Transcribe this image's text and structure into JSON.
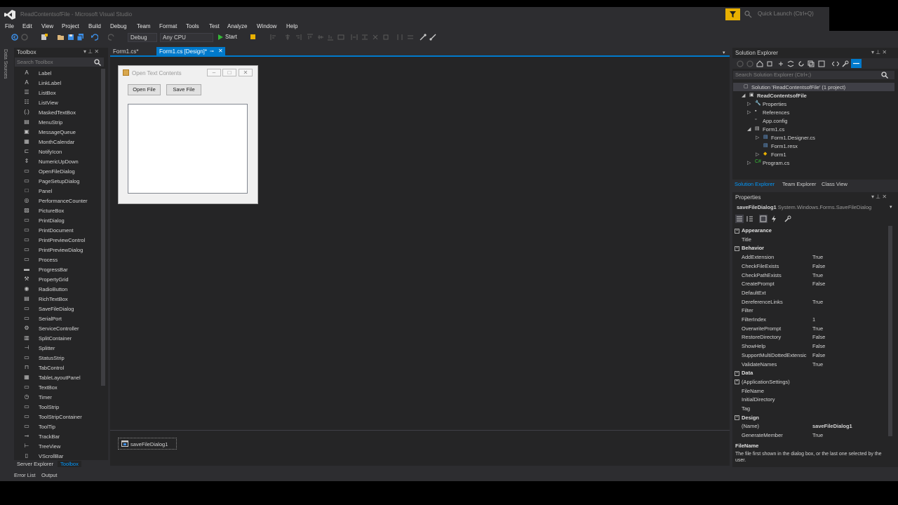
{
  "window": {
    "title": "ReadContentsofFile - Microsoft Visual Studio",
    "quick_launch_placeholder": "Quick Launch (Ctrl+Q)"
  },
  "menu": [
    "File",
    "Edit",
    "View",
    "Project",
    "Build",
    "Debug",
    "Team",
    "Format",
    "Tools",
    "Test",
    "Analyze",
    "Window",
    "Help"
  ],
  "toolbar": {
    "configuration": "Debug",
    "platform": "Any CPU",
    "start_label": "Start"
  },
  "side_strip": {
    "data_sources": "Data Sources"
  },
  "toolbox": {
    "title": "Toolbox",
    "search_placeholder": "Search Toolbox",
    "items": [
      {
        "icon": "A",
        "label": "Label"
      },
      {
        "icon": "A",
        "label": "LinkLabel"
      },
      {
        "icon": "☰",
        "label": "ListBox"
      },
      {
        "icon": "☷",
        "label": "ListView"
      },
      {
        "icon": "(.)",
        "label": "MaskedTextBox"
      },
      {
        "icon": "▤",
        "label": "MenuStrip"
      },
      {
        "icon": "▣",
        "label": "MessageQueue"
      },
      {
        "icon": "▦",
        "label": "MonthCalendar"
      },
      {
        "icon": "⊏",
        "label": "NotifyIcon"
      },
      {
        "icon": "⇕",
        "label": "NumericUpDown"
      },
      {
        "icon": "▭",
        "label": "OpenFileDialog"
      },
      {
        "icon": "▭",
        "label": "PageSetupDialog"
      },
      {
        "icon": "□",
        "label": "Panel"
      },
      {
        "icon": "◎",
        "label": "PerformanceCounter"
      },
      {
        "icon": "▨",
        "label": "PictureBox"
      },
      {
        "icon": "▭",
        "label": "PrintDialog"
      },
      {
        "icon": "▭",
        "label": "PrintDocument"
      },
      {
        "icon": "▭",
        "label": "PrintPreviewControl"
      },
      {
        "icon": "▭",
        "label": "PrintPreviewDialog"
      },
      {
        "icon": "▭",
        "label": "Process"
      },
      {
        "icon": "▬",
        "label": "ProgressBar"
      },
      {
        "icon": "⚒",
        "label": "PropertyGrid"
      },
      {
        "icon": "◉",
        "label": "RadioButton"
      },
      {
        "icon": "▤",
        "label": "RichTextBox"
      },
      {
        "icon": "▭",
        "label": "SaveFileDialog"
      },
      {
        "icon": "▭",
        "label": "SerialPort"
      },
      {
        "icon": "⚙",
        "label": "ServiceController"
      },
      {
        "icon": "▥",
        "label": "SplitContainer"
      },
      {
        "icon": "⊣",
        "label": "Splitter"
      },
      {
        "icon": "▭",
        "label": "StatusStrip"
      },
      {
        "icon": "⊓",
        "label": "TabControl"
      },
      {
        "icon": "▦",
        "label": "TableLayoutPanel"
      },
      {
        "icon": "▭",
        "label": "TextBox"
      },
      {
        "icon": "◷",
        "label": "Timer"
      },
      {
        "icon": "▭",
        "label": "ToolStrip"
      },
      {
        "icon": "▭",
        "label": "ToolStripContainer"
      },
      {
        "icon": "▭",
        "label": "ToolTip"
      },
      {
        "icon": "⊸",
        "label": "TrackBar"
      },
      {
        "icon": "⊢",
        "label": "TreeView"
      },
      {
        "icon": "▯",
        "label": "VScrollBar"
      }
    ],
    "tab_server_explorer": "Server Explorer",
    "tab_toolbox": "Toolbox"
  },
  "documents": {
    "tab1": "Form1.cs*",
    "tab2": "Form1.cs [Design]*"
  },
  "form": {
    "title": "Open Text Contents",
    "open_button": "Open File",
    "save_button": "Save File"
  },
  "tray": {
    "component": "saveFileDialog1"
  },
  "solution_explorer": {
    "title": "Solution Explorer",
    "search_placeholder": "Search Solution Explorer (Ctrl+;)",
    "tree": [
      {
        "label": "Solution 'ReadContentsofFile' (1 project)",
        "icon": "▢"
      },
      {
        "label": "ReadContentsofFile",
        "icon": "▣"
      },
      {
        "label": "Properties",
        "icon": "🔧"
      },
      {
        "label": "References",
        "icon": "▪"
      },
      {
        "label": "App.config",
        "icon": "▫"
      },
      {
        "label": "Form1.cs",
        "icon": "▤"
      },
      {
        "label": "Form1.Designer.cs",
        "icon": "▤"
      },
      {
        "label": "Form1.resx",
        "icon": "▤"
      },
      {
        "label": "Form1",
        "icon": "◆"
      },
      {
        "label": "Program.cs",
        "icon": "C#"
      }
    ],
    "tabs": [
      "Solution Explorer",
      "Team Explorer",
      "Class View"
    ]
  },
  "properties": {
    "title": "Properties",
    "object_name": "saveFileDialog1",
    "object_type": "System.Windows.Forms.SaveFileDialog",
    "rows": [
      {
        "cat": "Appearance"
      },
      {
        "name": "Title",
        "value": ""
      },
      {
        "cat": "Behavior"
      },
      {
        "name": "AddExtension",
        "value": "True"
      },
      {
        "name": "CheckFileExists",
        "value": "False"
      },
      {
        "name": "CheckPathExists",
        "value": "True"
      },
      {
        "name": "CreatePrompt",
        "value": "False"
      },
      {
        "name": "DefaultExt",
        "value": ""
      },
      {
        "name": "DereferenceLinks",
        "value": "True"
      },
      {
        "name": "Filter",
        "value": ""
      },
      {
        "name": "FilterIndex",
        "value": "1"
      },
      {
        "name": "OverwritePrompt",
        "value": "True"
      },
      {
        "name": "RestoreDirectory",
        "value": "False"
      },
      {
        "name": "ShowHelp",
        "value": "False"
      },
      {
        "name": "SupportMultiDottedExtensic",
        "value": "False"
      },
      {
        "name": "ValidateNames",
        "value": "True"
      },
      {
        "cat": "Data"
      },
      {
        "name": "(ApplicationSettings)",
        "value": "",
        "expand": true
      },
      {
        "name": "FileName",
        "value": ""
      },
      {
        "name": "InitialDirectory",
        "value": ""
      },
      {
        "name": "Tag",
        "value": ""
      },
      {
        "cat": "Design"
      },
      {
        "name": "(Name)",
        "value": "saveFileDialog1",
        "bold": true
      },
      {
        "name": "GenerateMember",
        "value": "True"
      }
    ],
    "desc_title": "FileName",
    "desc_text": "The file first shown in the dialog box, or the last one selected by the user."
  },
  "bottom_tabs": [
    "Error List",
    "Output"
  ],
  "colors": {
    "accent": "#007acc",
    "filter": "#e8b000",
    "background": "#2d2d30",
    "panel": "#252526"
  }
}
